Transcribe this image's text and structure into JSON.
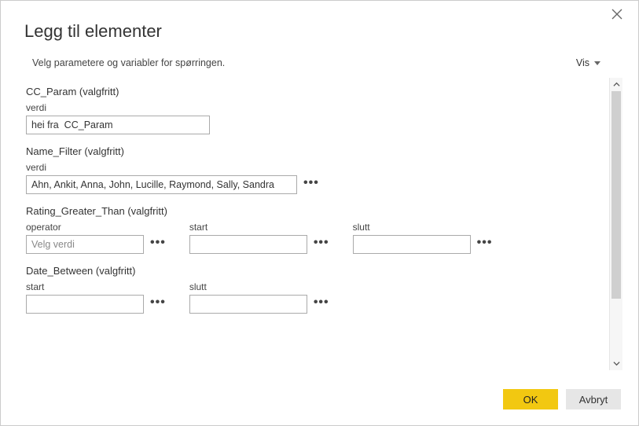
{
  "dialog": {
    "title": "Legg til elementer",
    "subtitle": "Velg parametere og variabler for spørringen.",
    "view_label": "Vis"
  },
  "groups": {
    "cc_param": {
      "title": "CC_Param (valgfritt)",
      "value_label": "verdi",
      "value": "hei fra  CC_Param"
    },
    "name_filter": {
      "title": "Name_Filter (valgfritt)",
      "value_label": "verdi",
      "value": "Ahn, Ankit, Anna, John, Lucille, Raymond, Sally, Sandra"
    },
    "rating_gt": {
      "title": "Rating_Greater_Than (valgfritt)",
      "operator_label": "operator",
      "operator_placeholder": "Velg verdi",
      "start_label": "start",
      "start_value": "",
      "end_label": "slutt",
      "end_value": ""
    },
    "date_between": {
      "title": "Date_Between (valgfritt)",
      "start_label": "start",
      "start_value": "",
      "end_label": "slutt",
      "end_value": ""
    }
  },
  "footer": {
    "ok": "OK",
    "cancel": "Avbryt"
  },
  "colors": {
    "accent": "#f2c811"
  }
}
